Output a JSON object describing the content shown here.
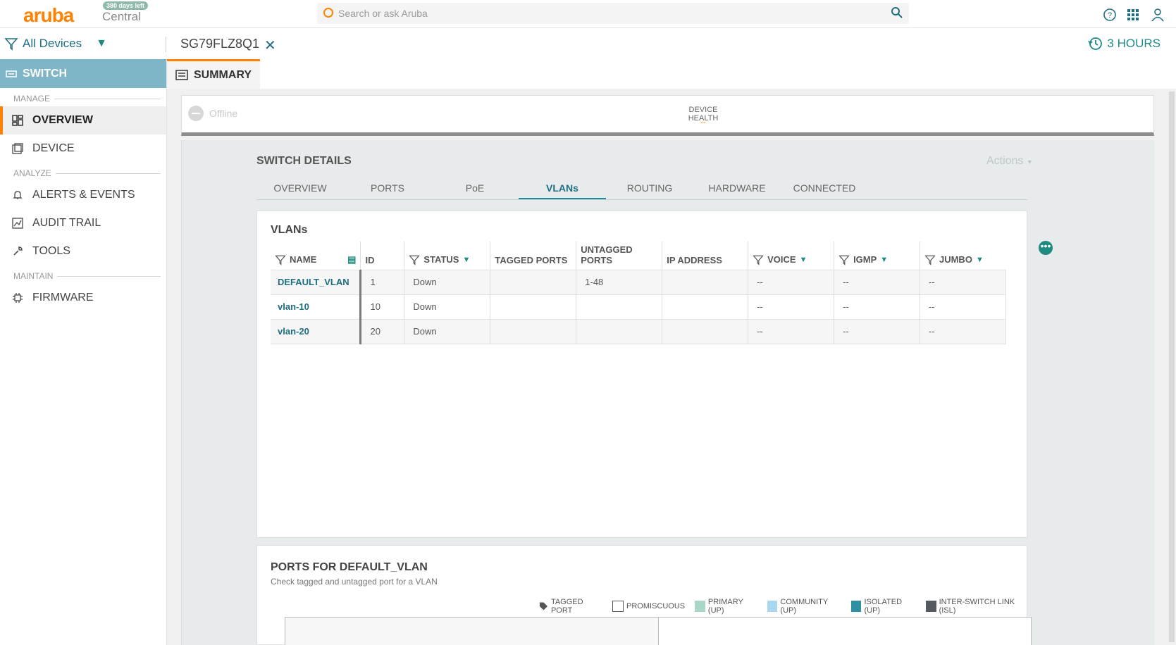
{
  "brand": {
    "name": "aruba",
    "product": "Central",
    "trial_badge": "380 days left"
  },
  "search": {
    "placeholder": "Search or ask Aruba"
  },
  "filter": {
    "label": "All Devices",
    "device": "SG79FLZ8Q1",
    "time_range": "3 HOURS"
  },
  "sidebar": {
    "header": "SWITCH",
    "sections": {
      "manage": "MANAGE",
      "analyze": "ANALYZE",
      "maintain": "MAINTAIN"
    },
    "items": {
      "overview": "OVERVIEW",
      "device": "DEVICE",
      "alerts": "ALERTS & EVENTS",
      "audit": "AUDIT TRAIL",
      "tools": "TOOLS",
      "firmware": "FIRMWARE"
    }
  },
  "summary_tab": "SUMMARY",
  "health": {
    "status": "Offline",
    "label": "DEVICE HEALTH",
    "value": "--"
  },
  "switch_details": {
    "title": "SWITCH DETAILS",
    "actions": "Actions",
    "tabs": [
      "OVERVIEW",
      "PORTS",
      "PoE",
      "VLANs",
      "ROUTING",
      "HARDWARE",
      "CONNECTED"
    ],
    "active_tab": "VLANs"
  },
  "vlans": {
    "title": "VLANs",
    "columns": [
      "NAME",
      "ID",
      "STATUS",
      "TAGGED PORTS",
      "UNTAGGED PORTS",
      "IP ADDRESS",
      "VOICE",
      "IGMP",
      "JUMBO"
    ],
    "rows": [
      {
        "name": "DEFAULT_VLAN",
        "id": "1",
        "status": "Down",
        "tagged": "",
        "untagged": "1-48",
        "ip": "",
        "voice": "--",
        "igmp": "--",
        "jumbo": "--"
      },
      {
        "name": "vlan-10",
        "id": "10",
        "status": "Down",
        "tagged": "",
        "untagged": "",
        "ip": "",
        "voice": "--",
        "igmp": "--",
        "jumbo": "--"
      },
      {
        "name": "vlan-20",
        "id": "20",
        "status": "Down",
        "tagged": "",
        "untagged": "",
        "ip": "",
        "voice": "--",
        "igmp": "--",
        "jumbo": "--"
      }
    ]
  },
  "ports": {
    "title": "PORTS FOR DEFAULT_VLAN",
    "subtitle": "Check tagged and untagged port for a VLAN",
    "legend": [
      {
        "label": "TAGGED PORT",
        "color": "tag-icon"
      },
      {
        "label": "PROMISCUOUS",
        "color": "#ffffff"
      },
      {
        "label": "PRIMARY (UP)",
        "color": "#a9d6c8"
      },
      {
        "label": "COMMUNITY (UP)",
        "color": "#a8d8f0"
      },
      {
        "label": "ISOLATED (UP)",
        "color": "#2f8fa3"
      },
      {
        "label": "INTER-SWITCH LINK (ISL)",
        "color": "#555a60"
      }
    ]
  },
  "colors": {
    "accent": "#ff8300",
    "teal": "#1f6d80",
    "sidebar_header": "#7fb6c7"
  }
}
